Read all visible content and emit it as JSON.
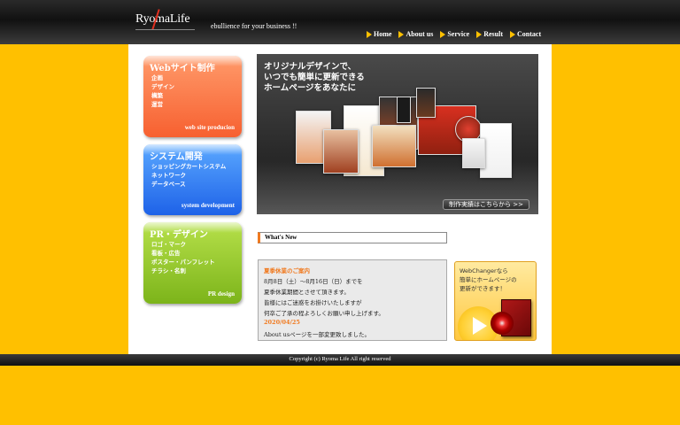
{
  "header": {
    "logo": "RyomaLife",
    "tagline": "ebullience for your business !!",
    "nav": [
      {
        "label": "Home"
      },
      {
        "label": "About us"
      },
      {
        "label": "Service"
      },
      {
        "label": "Result"
      },
      {
        "label": "Contact"
      }
    ]
  },
  "menu": {
    "web": {
      "title": "Webサイト制作",
      "items": [
        "企画",
        "デザイン",
        "構築",
        "運営"
      ],
      "sub": "web site producion"
    },
    "system": {
      "title": "システム開発",
      "items": [
        "ショッピングカートシステム",
        "ネットワーク",
        "データベース"
      ],
      "sub": "system development"
    },
    "pr": {
      "title": "PR・デザイン",
      "items": [
        "ロゴ・マーク",
        "看板・広告",
        "ポスター・パンフレット",
        "チラシ・名刺"
      ],
      "sub": "PR design"
    }
  },
  "banner": {
    "lines": [
      "オリジナルデザインで、",
      "いつでも簡単に更新できる",
      "ホームページをあなたに"
    ],
    "button": "制作実績はこちらから >>"
  },
  "whats_new": {
    "heading": "What's New"
  },
  "news": [
    {
      "text": "夏季休業のご案内",
      "style": "orange"
    },
    {
      "text": "8月8日（土）～8月16日（日）までを",
      "style": "normal"
    },
    {
      "text": "夏季休業期間とさせて頂きます。",
      "style": "normal"
    },
    {
      "text": "皆様にはご迷惑をお掛けいたしますが",
      "style": "normal"
    },
    {
      "text": "何卒ご了承の程よろしくお願い申し上げます。",
      "style": "normal"
    },
    {
      "text": "2020/04/25",
      "style": "orange"
    },
    {
      "text": "About usページを一部変更致しました。",
      "style": "normal"
    }
  ],
  "ad": {
    "lines": [
      "WebChangerなら",
      "簡単にホームページの",
      "更新ができます！"
    ]
  },
  "footer": {
    "copyright": "Copyright (c) Ryoma Life All right reserved"
  },
  "colors": {
    "background": "#ffc000",
    "web_box": "#f76030",
    "system_box": "#1e62e8",
    "pr_box": "#7cb41a",
    "accent": "#f07a20"
  }
}
